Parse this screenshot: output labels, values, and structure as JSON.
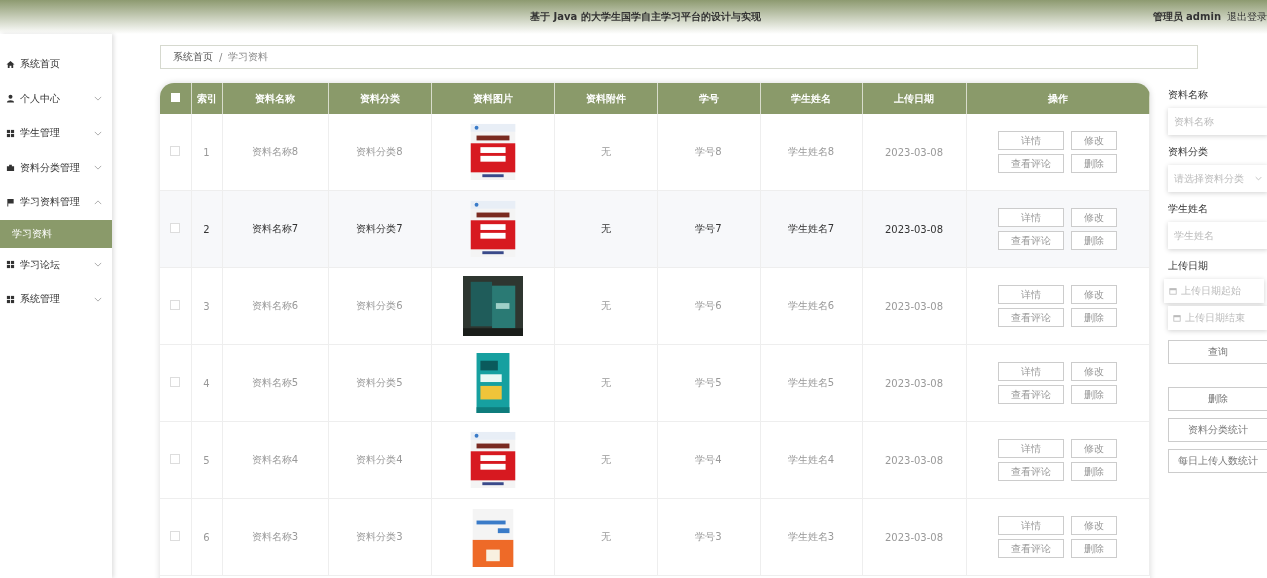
{
  "header": {
    "title": "基于 Java 的大学生国学自主学习平台的设计与实现",
    "user": "管理员 admin",
    "logout": "退出登录"
  },
  "sidebar": {
    "items": [
      {
        "label": "系统首页",
        "kind": "link"
      },
      {
        "label": "个人中心",
        "kind": "group",
        "expanded": false
      },
      {
        "label": "学生管理",
        "kind": "group",
        "expanded": false
      },
      {
        "label": "资料分类管理",
        "kind": "group",
        "expanded": false
      },
      {
        "label": "学习资料管理",
        "kind": "group",
        "expanded": true,
        "children": [
          {
            "label": "学习资料",
            "selected": true
          }
        ]
      },
      {
        "label": "学习论坛",
        "kind": "group",
        "expanded": false
      },
      {
        "label": "系统管理",
        "kind": "group",
        "expanded": false
      }
    ]
  },
  "breadcrumb": {
    "items": [
      "系统首页",
      "学习资料"
    ],
    "separator": "/"
  },
  "table": {
    "columns": [
      "索引",
      "资料名称",
      "资料分类",
      "资料图片",
      "资料附件",
      "学号",
      "学生姓名",
      "上传日期",
      "操作"
    ],
    "all_checked": false,
    "rows": [
      {
        "checked": false,
        "highlighted": false,
        "cells": [
          "1",
          "资料名称8",
          "资料分类8",
          {
            "kind": "picture"
          },
          "无",
          "学号8",
          "学生姓名8",
          "2023-03-08"
        ],
        "actions": [
          "详情",
          "修改",
          "查看评论",
          "删除"
        ]
      },
      {
        "checked": false,
        "highlighted": true,
        "cells": [
          "2",
          "资料名称7",
          "资料分类7",
          {
            "kind": "picture"
          },
          "无",
          "学号7",
          "学生姓名7",
          "2023-03-08"
        ],
        "actions": [
          "详情",
          "修改",
          "查看评论",
          "删除"
        ]
      },
      {
        "checked": false,
        "highlighted": false,
        "cells": [
          "3",
          "资料名称6",
          "资料分类6",
          {
            "kind": "picture"
          },
          "无",
          "学号6",
          "学生姓名6",
          "2023-03-08"
        ],
        "actions": [
          "详情",
          "修改",
          "查看评论",
          "删除"
        ]
      },
      {
        "checked": false,
        "highlighted": false,
        "cells": [
          "4",
          "资料名称5",
          "资料分类5",
          {
            "kind": "picture"
          },
          "无",
          "学号5",
          "学生姓名5",
          "2023-03-08"
        ],
        "actions": [
          "详情",
          "修改",
          "查看评论",
          "删除"
        ]
      },
      {
        "checked": false,
        "highlighted": false,
        "cells": [
          "5",
          "资料名称4",
          "资料分类4",
          {
            "kind": "picture"
          },
          "无",
          "学号4",
          "学生姓名4",
          "2023-03-08"
        ],
        "actions": [
          "详情",
          "修改",
          "查看评论",
          "删除"
        ]
      },
      {
        "checked": false,
        "highlighted": false,
        "cells": [
          "6",
          "资料名称3",
          "资料分类3",
          {
            "kind": "picture"
          },
          "无",
          "学号3",
          "学生姓名3",
          "2023-03-08"
        ],
        "actions": [
          "详情",
          "修改",
          "查看评论",
          "删除"
        ]
      }
    ]
  },
  "search": {
    "fields": [
      {
        "label": "资料名称",
        "kind": "text",
        "placeholder": "资料名称"
      },
      {
        "label": "资料分类",
        "kind": "select",
        "placeholder": "请选择资料分类"
      },
      {
        "label": "学生姓名",
        "kind": "text",
        "placeholder": "学生姓名"
      },
      {
        "label": "上传日期",
        "kind": "daterange",
        "placeholders": [
          "上传日期起始",
          "上传日期结束"
        ]
      }
    ],
    "buttons": [
      "查询",
      "删除",
      "资料分类统计",
      "每日上传人数统计"
    ]
  }
}
